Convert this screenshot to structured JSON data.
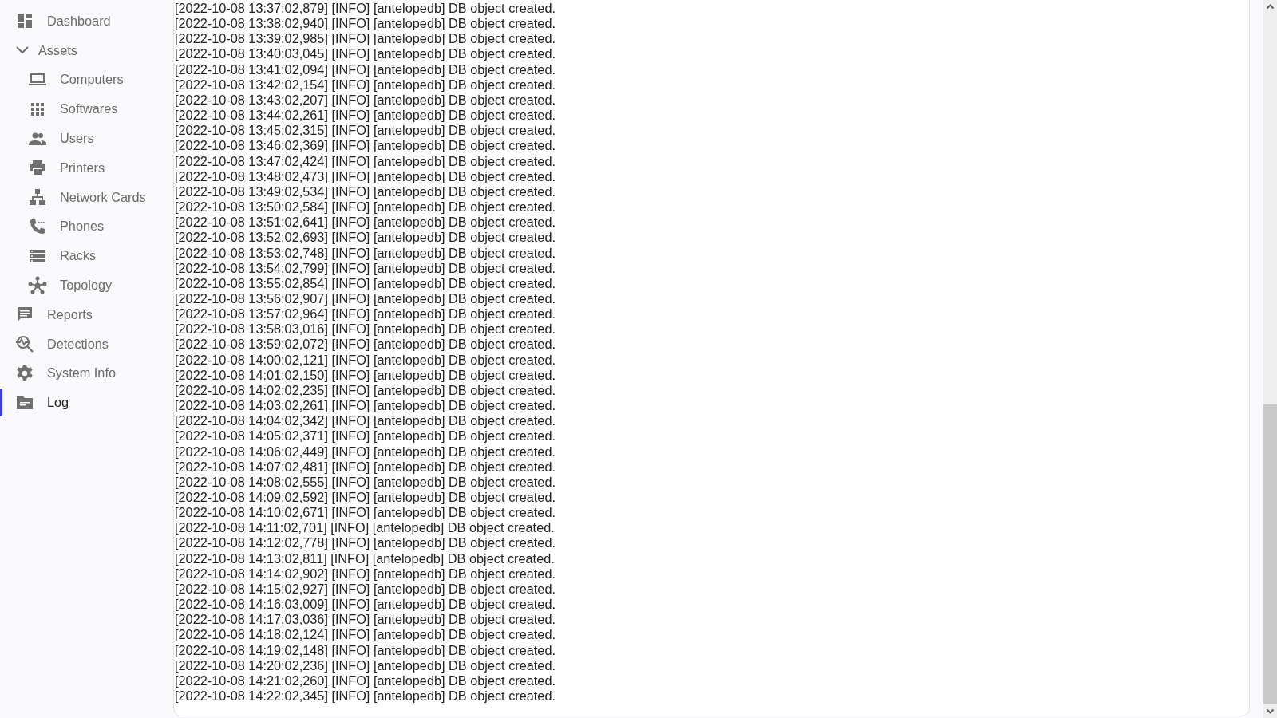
{
  "sidebar": {
    "items": [
      {
        "label": "Dashboard",
        "selected": false
      },
      {
        "label": "Assets",
        "selected": false,
        "expanded": true,
        "children": [
          {
            "label": "Computers",
            "selected": false
          },
          {
            "label": "Softwares",
            "selected": false
          },
          {
            "label": "Users",
            "selected": false
          },
          {
            "label": "Printers",
            "selected": false
          },
          {
            "label": "Network Cards",
            "selected": false
          },
          {
            "label": "Phones",
            "selected": false
          },
          {
            "label": "Racks",
            "selected": false
          },
          {
            "label": "Topology",
            "selected": false
          }
        ]
      },
      {
        "label": "Reports",
        "selected": false
      },
      {
        "label": "Detections",
        "selected": false
      },
      {
        "label": "System Info",
        "selected": false
      },
      {
        "label": "Log",
        "selected": true
      }
    ]
  },
  "log": {
    "lines": [
      "[2022-10-08 13:37:02,879] [INFO] [antelopedb] DB object created.",
      "[2022-10-08 13:38:02,940] [INFO] [antelopedb] DB object created.",
      "[2022-10-08 13:39:02,985] [INFO] [antelopedb] DB object created.",
      "[2022-10-08 13:40:03,045] [INFO] [antelopedb] DB object created.",
      "[2022-10-08 13:41:02,094] [INFO] [antelopedb] DB object created.",
      "[2022-10-08 13:42:02,154] [INFO] [antelopedb] DB object created.",
      "[2022-10-08 13:43:02,207] [INFO] [antelopedb] DB object created.",
      "[2022-10-08 13:44:02,261] [INFO] [antelopedb] DB object created.",
      "[2022-10-08 13:45:02,315] [INFO] [antelopedb] DB object created.",
      "[2022-10-08 13:46:02,369] [INFO] [antelopedb] DB object created.",
      "[2022-10-08 13:47:02,424] [INFO] [antelopedb] DB object created.",
      "[2022-10-08 13:48:02,473] [INFO] [antelopedb] DB object created.",
      "[2022-10-08 13:49:02,534] [INFO] [antelopedb] DB object created.",
      "[2022-10-08 13:50:02,584] [INFO] [antelopedb] DB object created.",
      "[2022-10-08 13:51:02,641] [INFO] [antelopedb] DB object created.",
      "[2022-10-08 13:52:02,693] [INFO] [antelopedb] DB object created.",
      "[2022-10-08 13:53:02,748] [INFO] [antelopedb] DB object created.",
      "[2022-10-08 13:54:02,799] [INFO] [antelopedb] DB object created.",
      "[2022-10-08 13:55:02,854] [INFO] [antelopedb] DB object created.",
      "[2022-10-08 13:56:02,907] [INFO] [antelopedb] DB object created.",
      "[2022-10-08 13:57:02,964] [INFO] [antelopedb] DB object created.",
      "[2022-10-08 13:58:03,016] [INFO] [antelopedb] DB object created.",
      "[2022-10-08 13:59:02,072] [INFO] [antelopedb] DB object created.",
      "[2022-10-08 14:00:02,121] [INFO] [antelopedb] DB object created.",
      "[2022-10-08 14:01:02,150] [INFO] [antelopedb] DB object created.",
      "[2022-10-08 14:02:02,235] [INFO] [antelopedb] DB object created.",
      "[2022-10-08 14:03:02,261] [INFO] [antelopedb] DB object created.",
      "[2022-10-08 14:04:02,342] [INFO] [antelopedb] DB object created.",
      "[2022-10-08 14:05:02,371] [INFO] [antelopedb] DB object created.",
      "[2022-10-08 14:06:02,449] [INFO] [antelopedb] DB object created.",
      "[2022-10-08 14:07:02,481] [INFO] [antelopedb] DB object created.",
      "[2022-10-08 14:08:02,555] [INFO] [antelopedb] DB object created.",
      "[2022-10-08 14:09:02,592] [INFO] [antelopedb] DB object created.",
      "[2022-10-08 14:10:02,671] [INFO] [antelopedb] DB object created.",
      "[2022-10-08 14:11:02,701] [INFO] [antelopedb] DB object created.",
      "[2022-10-08 14:12:02,778] [INFO] [antelopedb] DB object created.",
      "[2022-10-08 14:13:02,811] [INFO] [antelopedb] DB object created.",
      "[2022-10-08 14:14:02,902] [INFO] [antelopedb] DB object created.",
      "[2022-10-08 14:15:02,927] [INFO] [antelopedb] DB object created.",
      "[2022-10-08 14:16:03,009] [INFO] [antelopedb] DB object created.",
      "[2022-10-08 14:17:03,036] [INFO] [antelopedb] DB object created.",
      "[2022-10-08 14:18:02,124] [INFO] [antelopedb] DB object created.",
      "[2022-10-08 14:19:02,148] [INFO] [antelopedb] DB object created.",
      "[2022-10-08 14:20:02,236] [INFO] [antelopedb] DB object created.",
      "[2022-10-08 14:21:02,260] [INFO] [antelopedb] DB object created.",
      "[2022-10-08 14:22:02,345] [INFO] [antelopedb] DB object created."
    ]
  }
}
